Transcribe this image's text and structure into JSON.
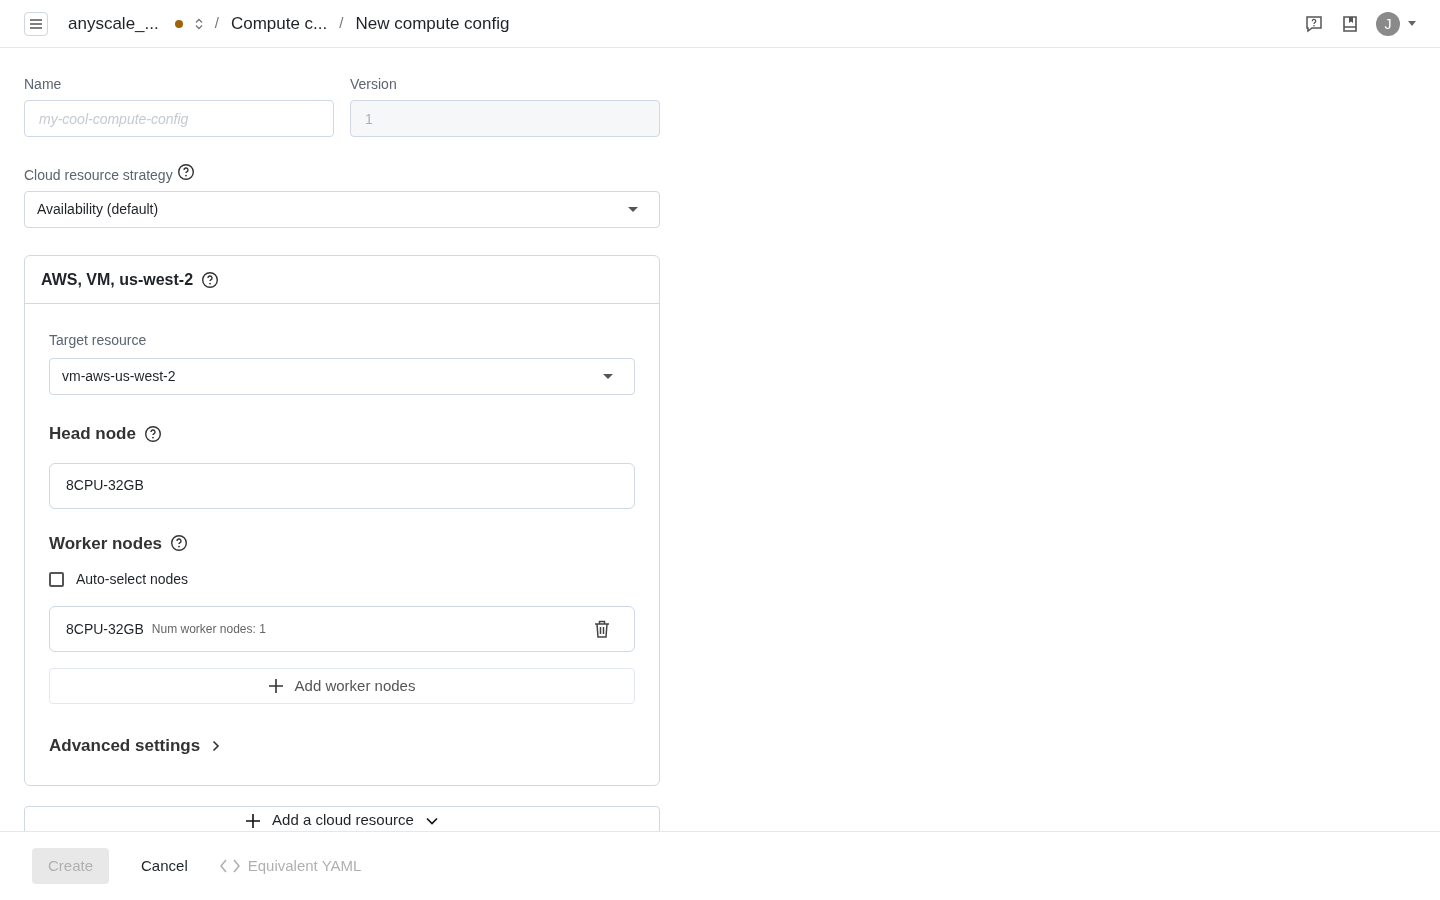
{
  "breadcrumbs": [
    {
      "label": "anyscale_...",
      "kind": "project",
      "color": "#a16207"
    },
    {
      "label": "/",
      "kind": "separator"
    },
    {
      "label": "Compute c...",
      "kind": "link"
    },
    {
      "label": "/",
      "kind": "separator"
    },
    {
      "label": "New compute config",
      "kind": "current"
    }
  ],
  "header": {
    "avatar": "J"
  },
  "name_field": {
    "label": "Name",
    "placeholder": "my-cool-compute-config"
  },
  "version_field": {
    "label": "Version",
    "value": "1",
    "disabled": true
  },
  "strategy": {
    "label": "Cloud resource strategy",
    "value": "Availability (default)"
  },
  "cloud_resource": {
    "title": "AWS, VM, us-west-2",
    "target": {
      "label": "Target resource",
      "value": "vm-aws-us-west-2"
    },
    "head_node": {
      "title": "Head node",
      "value": "8CPU-32GB"
    },
    "worker_nodes": {
      "title": "Worker nodes",
      "auto_select": {
        "label": "Auto-select nodes",
        "checked": false
      },
      "groups": [
        {
          "name": "8CPU-32GB",
          "detail": "Num worker nodes: 1"
        }
      ],
      "add_button": "Add worker nodes"
    },
    "advanced": {
      "label": "Advanced settings",
      "expanded": false
    }
  },
  "add_cloud_resource": "Add a cloud resource",
  "footer": [
    {
      "label": "Create",
      "kind": "primary",
      "disabled": true
    },
    {
      "label": "Cancel",
      "kind": "text",
      "disabled": false
    },
    {
      "label": "Equivalent YAML",
      "kind": "code",
      "disabled": true
    }
  ]
}
